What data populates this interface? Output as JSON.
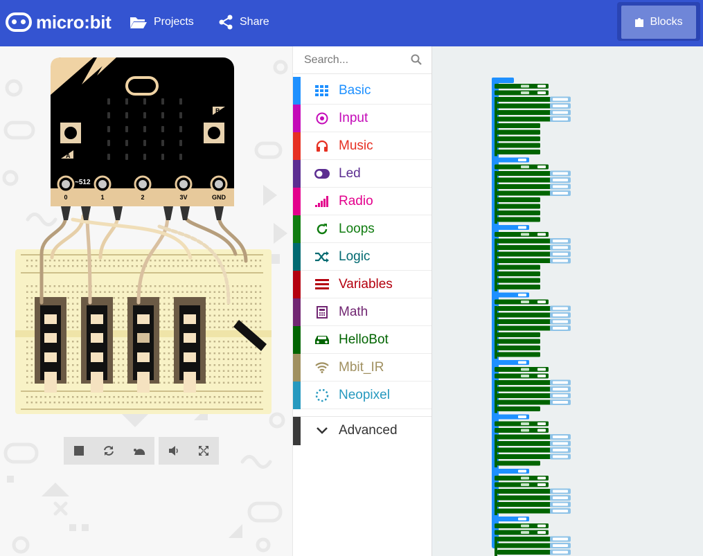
{
  "header": {
    "logo_text": "micro:bit",
    "projects_label": "Projects",
    "share_label": "Share",
    "blocks_label": "Blocks"
  },
  "simulator": {
    "pin_level_label": "~512",
    "pin_labels": [
      "0",
      "1",
      "2",
      "3V",
      "GND"
    ],
    "button_a": "A",
    "button_b": "B"
  },
  "search": {
    "placeholder": "Search..."
  },
  "categories": [
    {
      "label": "Basic",
      "color": "#1e90ff",
      "icon": "grid-icon"
    },
    {
      "label": "Input",
      "color": "#c40ab8",
      "icon": "target-icon"
    },
    {
      "label": "Music",
      "color": "#e63022",
      "icon": "headphones-icon"
    },
    {
      "label": "Led",
      "color": "#5c2d91",
      "icon": "toggle-icon"
    },
    {
      "label": "Radio",
      "color": "#e3008c",
      "icon": "signal-bars-icon"
    },
    {
      "label": "Loops",
      "color": "#107c10",
      "icon": "refresh-icon"
    },
    {
      "label": "Logic",
      "color": "#006970",
      "icon": "shuffle-icon"
    },
    {
      "label": "Variables",
      "color": "#b4000e",
      "icon": "list-icon"
    },
    {
      "label": "Math",
      "color": "#712672",
      "icon": "calculator-icon"
    },
    {
      "label": "HelloBot",
      "color": "#006400",
      "icon": "car-icon"
    },
    {
      "label": "Mbit_IR",
      "color": "#a09060",
      "icon": "wifi-icon"
    },
    {
      "label": "Neopixel",
      "color": "#2699bf",
      "icon": "dotted-circle-icon"
    }
  ],
  "advanced_label": "Advanced",
  "workspace": {
    "block_colors": {
      "event": "#1e90ff",
      "hellobot": "#006400",
      "basic": "#1e90ff"
    }
  }
}
